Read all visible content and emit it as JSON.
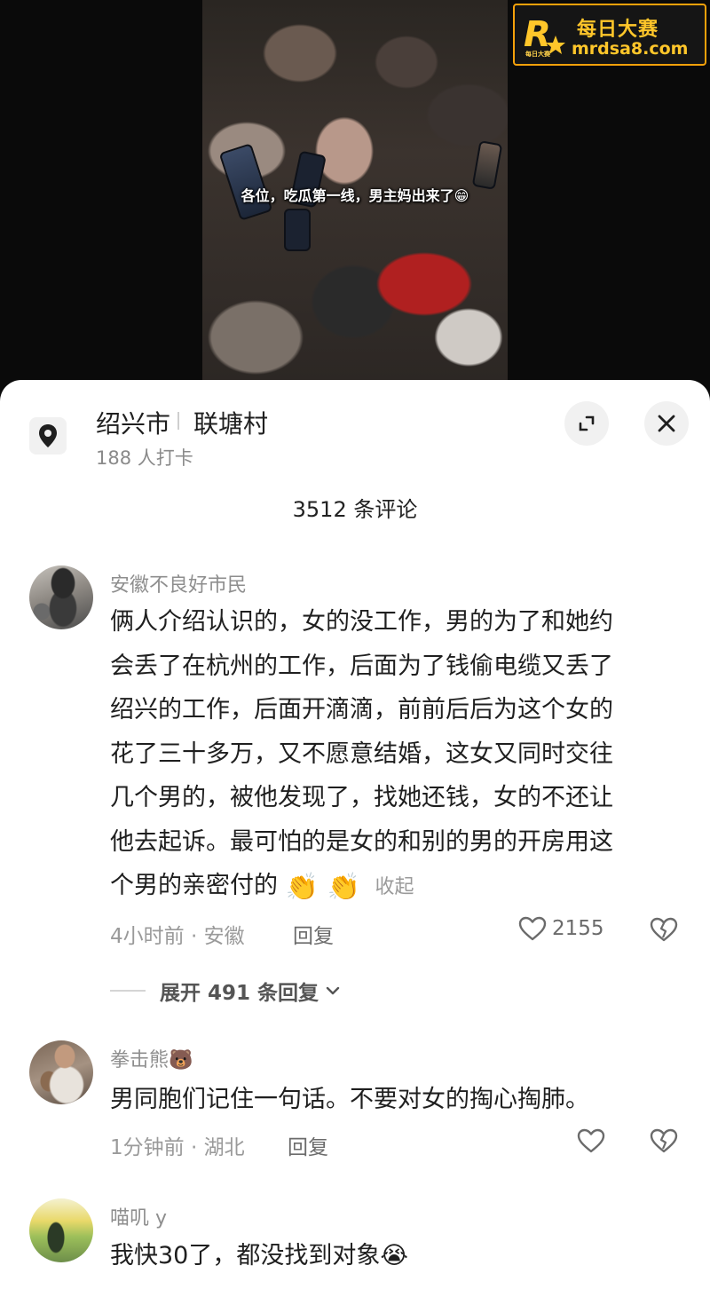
{
  "video": {
    "caption": "各位，吃瓜第一线，男主妈出来了😁"
  },
  "watermark": {
    "logo_letter": "R",
    "logo_small": "每日大赛",
    "title": "每日大赛",
    "site": "mrdsa8.com"
  },
  "location": {
    "city": "绍兴市",
    "village": "联塘村",
    "checkins": "188 人打卡"
  },
  "comments_header": {
    "count_label": "3512 条评论"
  },
  "comments": [
    {
      "username": "安徽不良好市民",
      "text_lines": [
        "俩人介绍认识的，女的没工作，男的为了和她约",
        "会丢了在杭州的工作，后面为了钱偷电缆又丢了",
        "绍兴的工作，后面开滴滴，前前后后为这个女的",
        "花了三十多万，又不愿意结婚，这女又同时交往",
        "几个男的，被他发现了，找她还钱，女的不还让",
        "他去起诉。最可怕的是女的和别的男的开房用这"
      ],
      "text_last": "个男的亲密付的",
      "emojis": "👏 👏",
      "collapse_label": "收起",
      "meta": "4小时前 · 安徽",
      "reply_label": "回复",
      "likes": "2155",
      "expand_label": "展开 491 条回复"
    },
    {
      "username": "拳击熊🐻",
      "text": "男同胞们记住一句话。不要对女的掏心掏肺。",
      "meta": "1分钟前 · 湖北",
      "reply_label": "回复"
    },
    {
      "username": "喵叽 y",
      "text": "我快30了，都没找到对象😭"
    }
  ],
  "colors": {
    "accent_watermark": "#f5a10a",
    "text_primary": "#1f1f1f",
    "text_secondary": "#8e8e8e"
  },
  "icons": [
    "location-pin-icon",
    "expand-icon",
    "close-icon",
    "heart-icon",
    "broken-heart-icon",
    "chevron-down-icon"
  ]
}
